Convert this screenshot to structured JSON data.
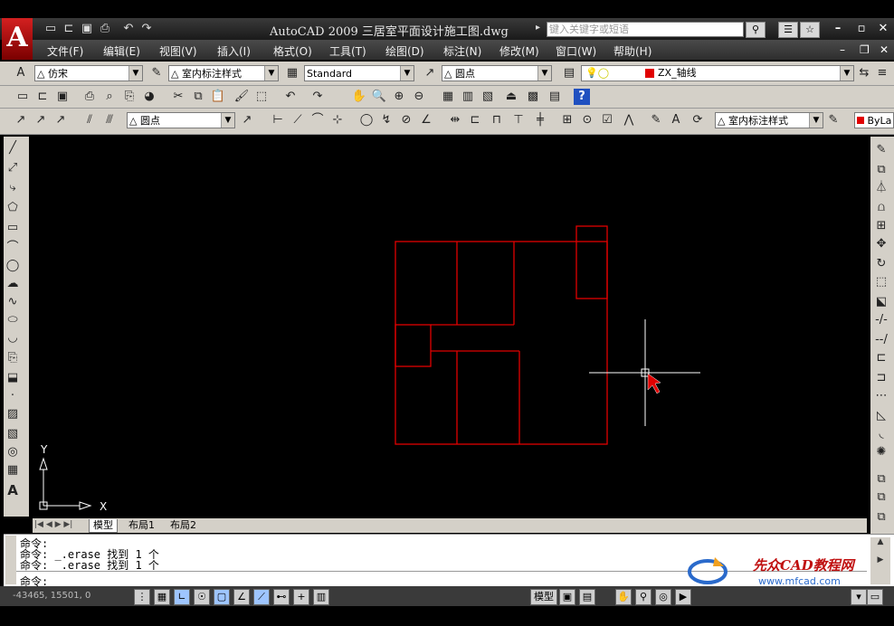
{
  "window": {
    "title": "AutoCAD 2009 三居室平面设计施工图.dwg",
    "search_placeholder": "键入关键字或短语",
    "logo": "A"
  },
  "menu": [
    "文件(F)",
    "编辑(E)",
    "视图(V)",
    "插入(I)",
    "格式(O)",
    "工具(T)",
    "绘图(D)",
    "标注(N)",
    "修改(M)",
    "窗口(W)",
    "帮助(H)"
  ],
  "styles_toolbar": {
    "text_style": "仿宋",
    "dim_style": "室内标注样式",
    "table_style": "Standard",
    "multileader_style": "圆点",
    "layer": "ZX_轴线"
  },
  "dim_toolbar": {
    "leader_style": "圆点",
    "dim_style": "室内标注样式",
    "color": "ByLa"
  },
  "ucs": {
    "x_label": "X",
    "y_label": "Y"
  },
  "layout_tabs": [
    "模型",
    "布局1",
    "布局2"
  ],
  "command_lines": [
    "命令:",
    "命令: _.erase 找到 1 个",
    "命令: _.erase 找到 1 个",
    "命令:"
  ],
  "status": {
    "coords": "-43465, 15501, 0",
    "space": "模型"
  },
  "watermark": {
    "brand": "先众CAD教程网",
    "url": "www.mfcad.com"
  },
  "colors": {
    "linework": "#e00000",
    "crosshair": "#ffffff",
    "background": "#000000"
  }
}
